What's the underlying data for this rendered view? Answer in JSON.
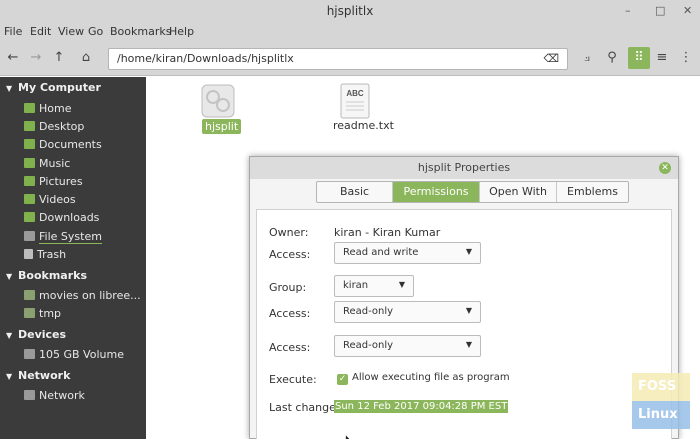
{
  "window": {
    "title": "hjsplitlx",
    "controls": [
      "–",
      "□",
      "✕"
    ]
  },
  "menu": [
    "File",
    "Edit",
    "View",
    "Go",
    "Bookmarks",
    "Help"
  ],
  "toolbar": {
    "path": "/home/kiran/Downloads/hjsplitlx",
    "icons": [
      "back-arrow-icon",
      "forward-arrow-icon",
      "up-arrow-icon",
      "home-icon",
      "clear-icon",
      "toggle-location-icon",
      "search-icon",
      "icon-view-icon",
      "list-view-icon",
      "compact-view-icon"
    ]
  },
  "sidebar": {
    "sections": [
      {
        "header": "My Computer",
        "items": [
          "Home",
          "Desktop",
          "Documents",
          "Music",
          "Pictures",
          "Videos",
          "Downloads",
          "File System",
          "Trash"
        ]
      },
      {
        "header": "Bookmarks",
        "items": [
          "movies on libree...",
          "tmp"
        ]
      },
      {
        "header": "Devices",
        "items": [
          "105 GB Volume"
        ]
      },
      {
        "header": "Network",
        "items": [
          "Network"
        ]
      }
    ]
  },
  "files": [
    {
      "name": "hjsplit",
      "selected": true,
      "icon": "executable-icon"
    },
    {
      "name": "readme.txt",
      "selected": false,
      "icon": "text-file-icon",
      "icon_text": "ABC"
    }
  ],
  "dialog": {
    "title": "hjsplit Properties",
    "tabs": [
      "Basic",
      "Permissions",
      "Open With",
      "Emblems"
    ],
    "active_tab": "Permissions",
    "owner_label": "Owner:",
    "owner_value": "kiran - Kiran Kumar",
    "owner_access_label": "Access:",
    "owner_access_value": "Read and write",
    "group_label": "Group:",
    "group_value": "kiran",
    "group_access_label": "Access:",
    "group_access_value": "Read-only",
    "others_access_label": "Access:",
    "others_access_value": "Read-only",
    "execute_label": "Execute:",
    "execute_checkbox_label": "Allow executing file as program",
    "execute_checked": true,
    "last_changed_label": "Last changed:",
    "last_changed_value": "Sun 12 Feb 2017 09:04:28 PM EST"
  },
  "watermark": {
    "line1": "FOSS",
    "line2": "Linux"
  },
  "colors": {
    "accent": "#8cb65b",
    "sidebar_bg": "#3b3b3b",
    "chrome": "#d6d6d6"
  }
}
